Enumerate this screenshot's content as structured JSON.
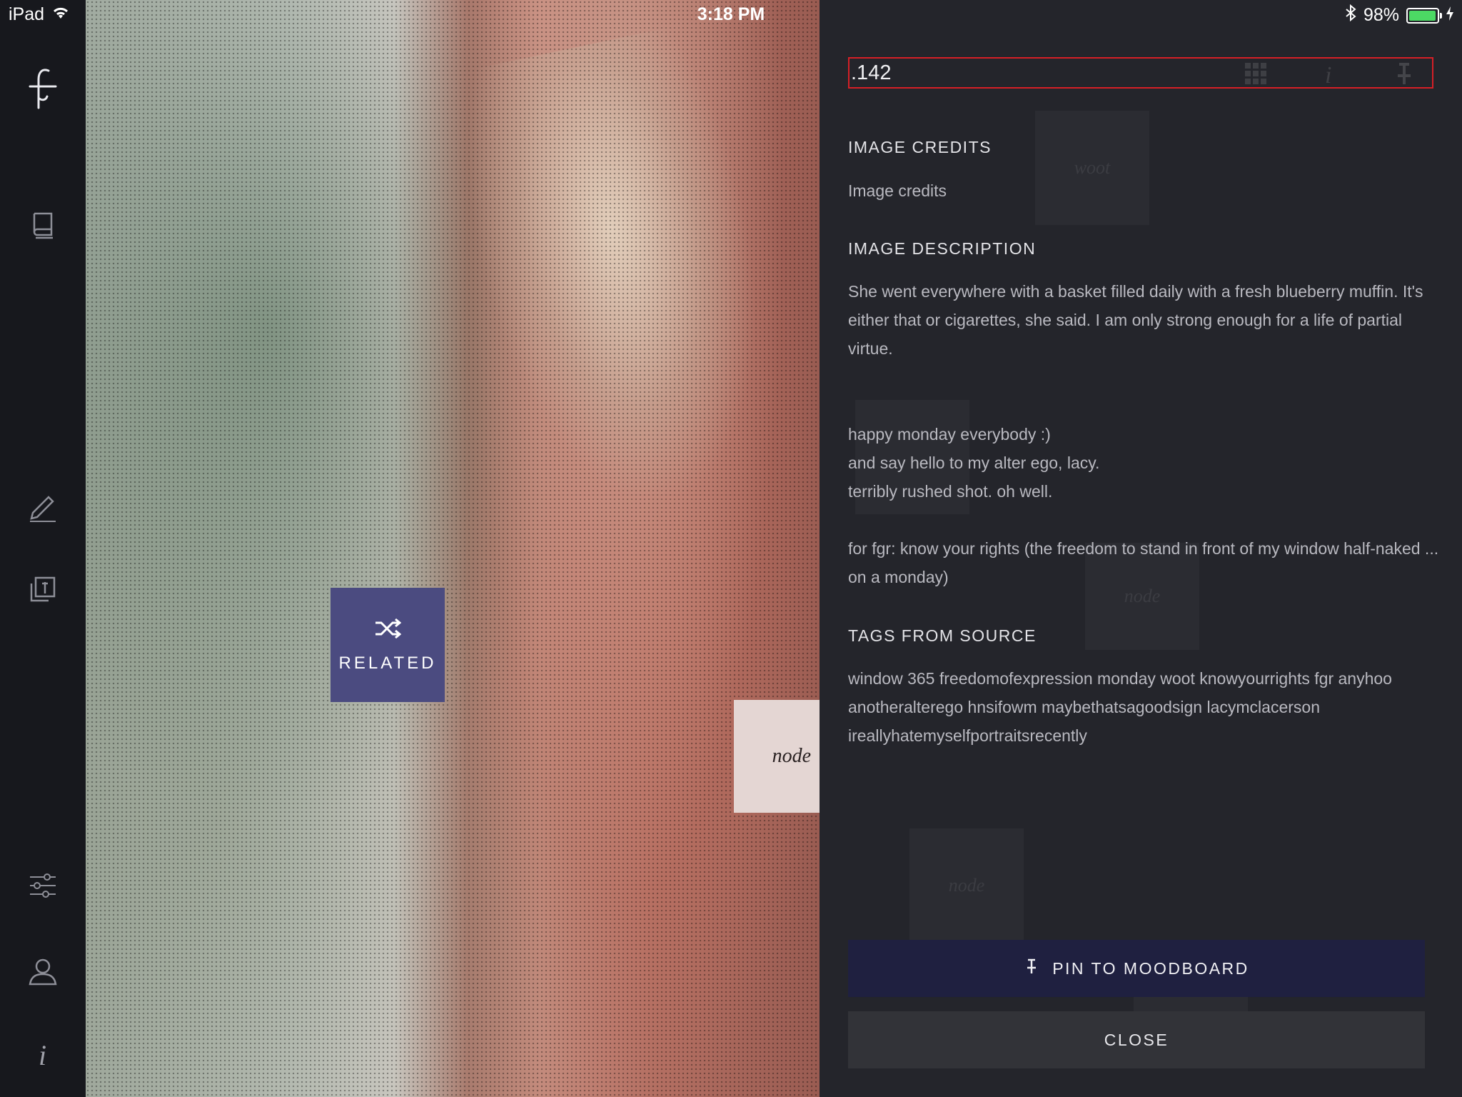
{
  "status_bar": {
    "device": "iPad",
    "time": "3:18 PM",
    "battery_percent": "98%",
    "battery_level": 0.98
  },
  "sidebar": {
    "icons": [
      "logo-icon",
      "book-icon",
      "pencil-icon",
      "pinned-stack-icon",
      "sliders-icon",
      "user-icon",
      "info-icon"
    ]
  },
  "photo": {
    "related_label": "RELATED",
    "node_label": "node"
  },
  "panel": {
    "image_id": ".142",
    "credits_title": "IMAGE CREDITS",
    "credits_text": "Image credits",
    "description_title": "IMAGE DESCRIPTION",
    "description_paragraphs": [
      "She went everywhere with a basket filled daily with a fresh blueberry muffin. It's either that or cigarettes, she said. I am only strong enough for a life of partial virtue.",
      "happy monday everybody :)",
      "and say hello to my alter ego, lacy.",
      "terribly rushed shot. oh well.",
      "for fgr: know your rights (the freedom to stand in front of my window half-naked ... on a monday)"
    ],
    "tags_title": "TAGS FROM SOURCE",
    "tags_text": "window 365 freedomofexpression monday woot knowyourrights fgr anyhoo anotheralterego hnsifowm maybethatsagoodsign lacymclacerson ireallyhatemyselfportraitsrecently",
    "ghost_tiles": [
      "woot",
      "node",
      "node",
      "node"
    ],
    "pin_label": "PIN TO MOODBOARD",
    "close_label": "CLOSE"
  },
  "colors": {
    "related": "#4b4b80",
    "pin_button": "#1f2040",
    "close_button": "#323338",
    "highlight_border": "#d61f26"
  }
}
